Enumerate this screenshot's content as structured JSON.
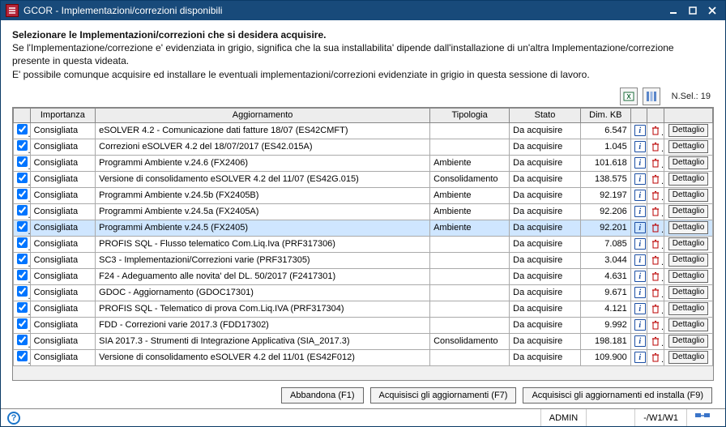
{
  "window": {
    "title": "GCOR - Implementazioni/correzioni disponibili"
  },
  "instructions": {
    "line1_bold": "Selezionare le Implementazioni/correzioni che si desidera acquisire.",
    "line2": "Se l'Implementazione/correzione e' evidenziata in grigio, significa che la sua installabilita' dipende dall'installazione di un'altra Implementazione/correzione presente in questa videata.",
    "line3": "E' possibile comunque acquisire ed installare le eventuali implementazioni/correzioni evidenziate in grigio in questa sessione di lavoro."
  },
  "toolbar": {
    "nsel_label": "N.Sel.:",
    "nsel_value": "19"
  },
  "headers": {
    "importanza": "Importanza",
    "aggiornamento": "Aggiornamento",
    "tipologia": "Tipologia",
    "stato": "Stato",
    "dimkb": "Dim. KB"
  },
  "detail_label": "Dettaglio",
  "rows": [
    {
      "chk": true,
      "imp": "Consigliata",
      "agg": "eSOLVER 4.2 - Comunicazione dati fatture 18/07 (ES42CMFT)",
      "tip": "",
      "stato": "Da acquisire",
      "dim": "6.547",
      "sel": false
    },
    {
      "chk": true,
      "imp": "Consigliata",
      "agg": "Correzioni eSOLVER 4.2 del 18/07/2017 (ES42.015A)",
      "tip": "",
      "stato": "Da acquisire",
      "dim": "1.045",
      "sel": false
    },
    {
      "chk": true,
      "imp": "Consigliata",
      "agg": "Programmi Ambiente v.24.6 (FX2406)",
      "tip": "Ambiente",
      "stato": "Da acquisire",
      "dim": "101.618",
      "sel": false
    },
    {
      "chk": true,
      "imp": "Consigliata",
      "agg": "Versione di consolidamento eSOLVER 4.2 del 11/07 (ES42G.015)",
      "tip": "Consolidamento",
      "stato": "Da acquisire",
      "dim": "138.575",
      "sel": false
    },
    {
      "chk": true,
      "imp": "Consigliata",
      "agg": "Programmi Ambiente v.24.5b (FX2405B)",
      "tip": "Ambiente",
      "stato": "Da acquisire",
      "dim": "92.197",
      "sel": false
    },
    {
      "chk": true,
      "imp": "Consigliata",
      "agg": "Programmi Ambiente v.24.5a (FX2405A)",
      "tip": "Ambiente",
      "stato": "Da acquisire",
      "dim": "92.206",
      "sel": false
    },
    {
      "chk": true,
      "imp": "Consigliata",
      "agg": "Programmi Ambiente v.24.5 (FX2405)",
      "tip": "Ambiente",
      "stato": "Da acquisire",
      "dim": "92.201",
      "sel": true
    },
    {
      "chk": true,
      "imp": "Consigliata",
      "agg": "PROFIS SQL - Flusso telematico Com.Liq.Iva (PRF317306)",
      "tip": "",
      "stato": "Da acquisire",
      "dim": "7.085",
      "sel": false
    },
    {
      "chk": true,
      "imp": "Consigliata",
      "agg": "SC3 - Implementazioni/Correzioni varie (PRF317305)",
      "tip": "",
      "stato": "Da acquisire",
      "dim": "3.044",
      "sel": false
    },
    {
      "chk": true,
      "imp": "Consigliata",
      "agg": "F24 - Adeguamento alle novita' del DL. 50/2017 (F2417301)",
      "tip": "",
      "stato": "Da acquisire",
      "dim": "4.631",
      "sel": false
    },
    {
      "chk": true,
      "imp": "Consigliata",
      "agg": "GDOC - Aggiornamento (GDOC17301)",
      "tip": "",
      "stato": "Da acquisire",
      "dim": "9.671",
      "sel": false
    },
    {
      "chk": true,
      "imp": "Consigliata",
      "agg": "PROFIS SQL - Telematico di prova Com.Liq.IVA (PRF317304)",
      "tip": "",
      "stato": "Da acquisire",
      "dim": "4.121",
      "sel": false
    },
    {
      "chk": true,
      "imp": "Consigliata",
      "agg": "FDD - Correzioni varie 2017.3 (FDD17302)",
      "tip": "",
      "stato": "Da acquisire",
      "dim": "9.992",
      "sel": false
    },
    {
      "chk": true,
      "imp": "Consigliata",
      "agg": "SIA 2017.3 - Strumenti di Integrazione Applicativa (SIA_2017.3)",
      "tip": "Consolidamento",
      "stato": "Da acquisire",
      "dim": "198.181",
      "sel": false
    },
    {
      "chk": true,
      "imp": "Consigliata",
      "agg": "Versione di consolidamento eSOLVER 4.2 del 11/01 (ES42F012)",
      "tip": "",
      "stato": "Da acquisire",
      "dim": "109.900",
      "sel": false
    }
  ],
  "buttons": {
    "abbandona": "Abbandona (F1)",
    "acquisisci": "Acquisisci gli aggiornamenti (F7)",
    "acquisisci_installa": "Acquisisci gli aggiornamenti ed installa (F9)"
  },
  "statusbar": {
    "admin": "ADMIN",
    "ws": "-/W1/W1"
  }
}
